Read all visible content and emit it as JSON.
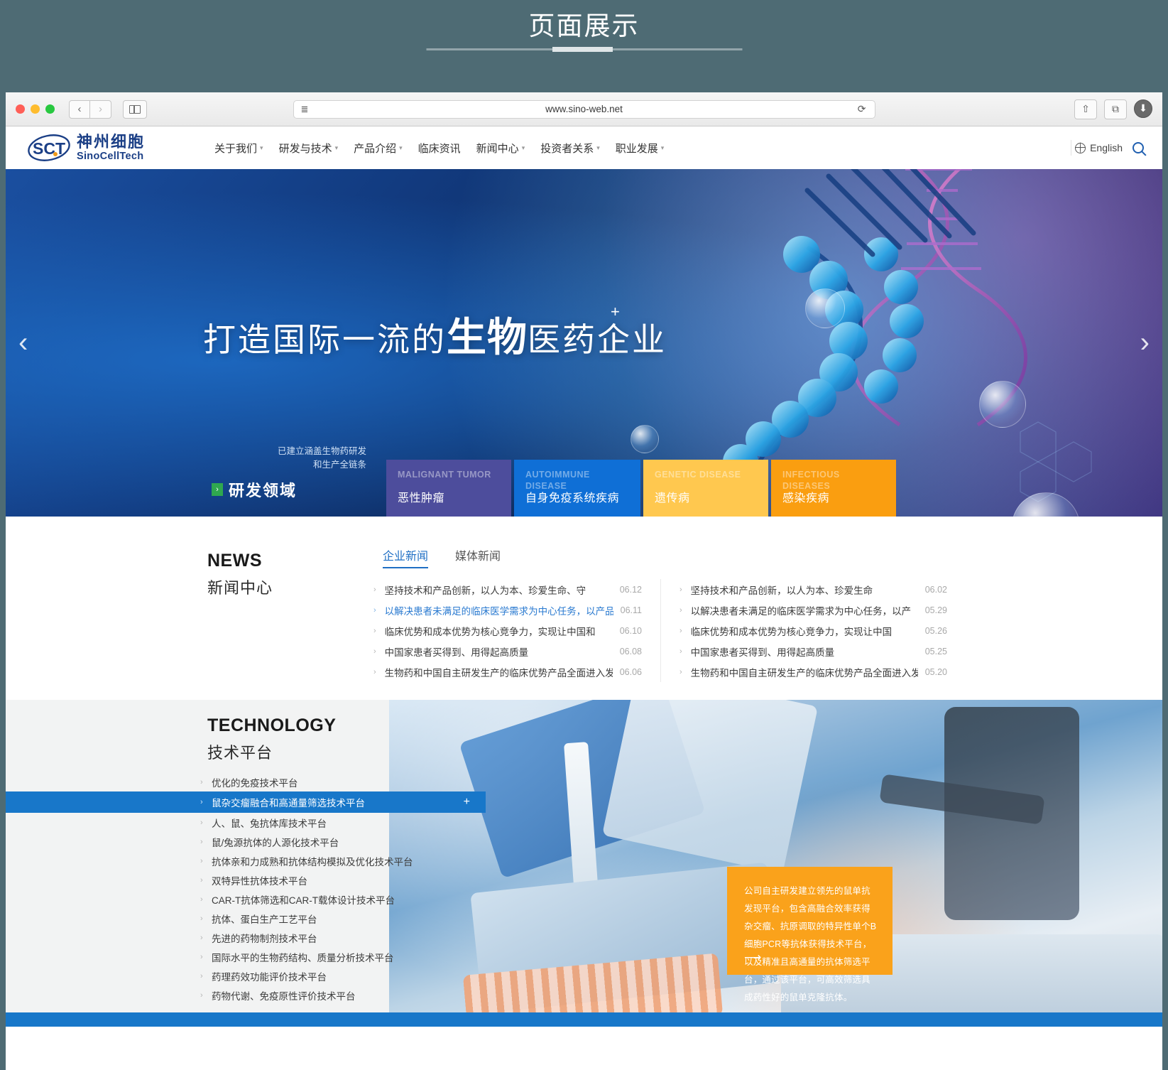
{
  "page": {
    "title": "页面展示"
  },
  "browser": {
    "url": "www.sino-web.net",
    "back_label": "‹",
    "forward_label": "›",
    "reload_label": "⟳",
    "reader_label": "≣",
    "share_label": "⇧",
    "tabs_label": "⧉",
    "download_label": "⬇"
  },
  "site": {
    "logo": {
      "cn": "神州细胞",
      "en": "SinoCellTech",
      "mark": "SCT"
    },
    "menu": [
      {
        "label": "关于我们",
        "has_dropdown": true
      },
      {
        "label": "研发与技术",
        "has_dropdown": true
      },
      {
        "label": "产品介绍",
        "has_dropdown": true
      },
      {
        "label": "临床资讯",
        "has_dropdown": false
      },
      {
        "label": "新闻中心",
        "has_dropdown": true
      },
      {
        "label": "投资者关系",
        "has_dropdown": true
      },
      {
        "label": "职业发展",
        "has_dropdown": true
      }
    ],
    "language": "English",
    "search_icon": "search-icon"
  },
  "hero": {
    "title_pre": "打造国际一流的",
    "title_accent": "生物",
    "title_post": "医药企业",
    "plus": "+",
    "prev_arrow": "‹",
    "next_arrow": "›",
    "sub_line1": "已建立涵盖生物药研发",
    "sub_line2": "和生产全链条",
    "cta_chip": "›",
    "cta_text": "研发领域",
    "tiles": [
      {
        "en": "MALIGNANT TUMOR",
        "cn": "恶性肿瘤",
        "color": "#4d4d9c"
      },
      {
        "en": "AUTOIMMUNE DISEASE",
        "cn": "自身免疫系统疾病",
        "color": "#0f6fd6"
      },
      {
        "en": "GENETIC DISEASE",
        "cn": "遗传病",
        "color": "#ffc84f"
      },
      {
        "en": "INFECTIOUS DISEASES",
        "cn": "感染疾病",
        "color": "#fa9e10"
      }
    ]
  },
  "news": {
    "heading_en": "NEWS",
    "heading_cn": "新闻中心",
    "tabs": [
      {
        "label": "企业新闻",
        "active": true
      },
      {
        "label": "媒体新闻",
        "active": false
      }
    ],
    "left_items": [
      {
        "text": "坚持技术和产品创新，以人为本、珍爱生命、守",
        "date": "06.12",
        "highlight": false
      },
      {
        "text": "以解决患者未满足的临床医学需求为中心任务，以产品",
        "date": "06.11",
        "highlight": true
      },
      {
        "text": "临床优势和成本优势为核心竞争力，实现让中国和",
        "date": "06.10",
        "highlight": false
      },
      {
        "text": "中国家患者买得到、用得起高质量",
        "date": "06.08",
        "highlight": false
      },
      {
        "text": "生物药和中国自主研发生产的临床优势产品全面进入发达国",
        "date": "06.06",
        "highlight": false
      }
    ],
    "right_items": [
      {
        "text": "坚持技术和产品创新，以人为本、珍爱生命",
        "date": "06.02",
        "highlight": false
      },
      {
        "text": "以解决患者未满足的临床医学需求为中心任务，以产",
        "date": "05.29",
        "highlight": false
      },
      {
        "text": "临床优势和成本优势为核心竞争力，实现让中国",
        "date": "05.26",
        "highlight": false
      },
      {
        "text": "中国家患者买得到、用得起高质量",
        "date": "05.25",
        "highlight": false
      },
      {
        "text": "生物药和中国自主研发生产的临床优势产品全面进入发",
        "date": "05.20",
        "highlight": false
      }
    ]
  },
  "technology": {
    "heading_en": "TECHNOLOGY",
    "heading_cn": "技术平台",
    "items": [
      {
        "label": "优化的免疫技术平台",
        "active": false
      },
      {
        "label": "鼠杂交瘤融合和高通量筛选技术平台",
        "active": true
      },
      {
        "label": "人、鼠、兔抗体库技术平台",
        "active": false
      },
      {
        "label": "鼠/兔源抗体的人源化技术平台",
        "active": false
      },
      {
        "label": "抗体亲和力成熟和抗体结构模拟及优化技术平台",
        "active": false
      },
      {
        "label": "双特异性抗体技术平台",
        "active": false
      },
      {
        "label": "CAR-T抗体筛选和CAR-T载体设计技术平台",
        "active": false
      },
      {
        "label": "抗体、蛋白生产工艺平台",
        "active": false
      },
      {
        "label": "先进的药物制剂技术平台",
        "active": false
      },
      {
        "label": "国际水平的生物药结构、质量分析技术平台",
        "active": false
      },
      {
        "label": "药理药效功能评价技术平台",
        "active": false
      },
      {
        "label": "药物代谢、免疫原性评价技术平台",
        "active": false
      }
    ],
    "active_plus": "+",
    "callout": {
      "text": "公司自主研发建立领先的鼠单抗发现平台，包含高融合效率获得杂交瘤、抗原调取的特异性单个B细胞PCR等抗体获得技术平台，以及精准且高通量的抗体筛选平台，通过该平台，可高效筛选具成药性好的鼠单克隆抗体。",
      "more_arrow": "⟶",
      "color": "#faa21b"
    }
  },
  "colors": {
    "brand_blue": "#1b3f86",
    "accent_blue": "#1877c9",
    "accent_orange": "#faa21b",
    "news_link": "#2a7ad0"
  }
}
